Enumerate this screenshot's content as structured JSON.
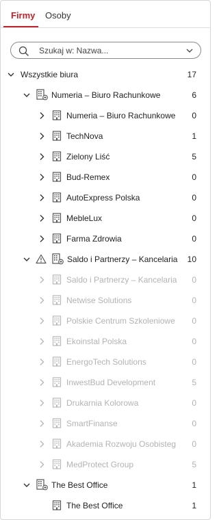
{
  "tabs": [
    {
      "label": "Firmy",
      "active": true
    },
    {
      "label": "Osoby",
      "active": false
    }
  ],
  "search": {
    "placeholder": "Szukaj w: Nazwa..."
  },
  "colors": {
    "accent": "#b8232c",
    "text": "#222222",
    "muted": "#b3b3b3"
  },
  "tree": [
    {
      "label": "Wszystkie biura",
      "count": "17",
      "level": 0,
      "chevron": "down",
      "icon": "none",
      "dim": false
    },
    {
      "label": "Numeria – Biuro Rachunkowe",
      "count": "6",
      "level": 1,
      "chevron": "down",
      "icon": "office-group",
      "dim": false
    },
    {
      "label": "Numeria – Biuro Rachunkowe",
      "count": "0",
      "level": 2,
      "chevron": "right",
      "icon": "building",
      "dim": false
    },
    {
      "label": "TechNova",
      "count": "1",
      "level": 2,
      "chevron": "right",
      "icon": "building",
      "dim": false
    },
    {
      "label": "Zielony Liść",
      "count": "5",
      "level": 2,
      "chevron": "right",
      "icon": "building",
      "dim": false
    },
    {
      "label": "Bud-Remex",
      "count": "0",
      "level": 2,
      "chevron": "right",
      "icon": "building",
      "dim": false
    },
    {
      "label": "AutoExpress Polska",
      "count": "0",
      "level": 2,
      "chevron": "right",
      "icon": "building",
      "dim": false
    },
    {
      "label": "MebleLux",
      "count": "0",
      "level": 2,
      "chevron": "right",
      "icon": "building",
      "dim": false
    },
    {
      "label": "Farma Zdrowia",
      "count": "0",
      "level": 2,
      "chevron": "right",
      "icon": "building",
      "dim": false
    },
    {
      "label": "Saldo i Partnerzy – Kancelaria",
      "count": "10",
      "level": 1,
      "chevron": "down",
      "icon": "office-group",
      "warning": true,
      "dim": false
    },
    {
      "label": "Saldo i Partnerzy – Kancelaria",
      "count": "0",
      "level": 2,
      "chevron": "right",
      "icon": "building",
      "dim": true
    },
    {
      "label": "Netwise Solutions",
      "count": "0",
      "level": 2,
      "chevron": "right",
      "icon": "building",
      "dim": true
    },
    {
      "label": "Polskie Centrum Szkoleniowe",
      "count": "0",
      "level": 2,
      "chevron": "right",
      "icon": "building",
      "dim": true
    },
    {
      "label": "Ekoinstal Polska",
      "count": "0",
      "level": 2,
      "chevron": "right",
      "icon": "building",
      "dim": true
    },
    {
      "label": "EnergoTech Solutions",
      "count": "0",
      "level": 2,
      "chevron": "right",
      "icon": "building",
      "dim": true
    },
    {
      "label": "InwestBud Development",
      "count": "5",
      "level": 2,
      "chevron": "right",
      "icon": "building",
      "dim": true
    },
    {
      "label": "Drukarnia Kolorowa",
      "count": "0",
      "level": 2,
      "chevron": "right",
      "icon": "building",
      "dim": true
    },
    {
      "label": "SmartFinanse",
      "count": "0",
      "level": 2,
      "chevron": "right",
      "icon": "building",
      "dim": true
    },
    {
      "label": "Akademia Rozwoju Osobisteg",
      "count": "0",
      "level": 2,
      "chevron": "right",
      "icon": "building",
      "dim": true
    },
    {
      "label": "MedProtect Group",
      "count": "5",
      "level": 2,
      "chevron": "right",
      "icon": "building",
      "dim": true
    },
    {
      "label": "The Best Office",
      "count": "1",
      "level": 1,
      "chevron": "down",
      "icon": "office-group",
      "dim": false
    },
    {
      "label": "The Best Office",
      "count": "1",
      "level": 2,
      "chevron": "none",
      "icon": "building",
      "dim": false
    }
  ]
}
